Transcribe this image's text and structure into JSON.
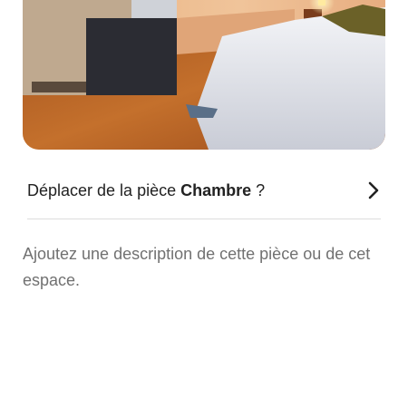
{
  "photo": {
    "icon": "bedroom-photo"
  },
  "room_link": {
    "prefix": "Déplacer de la pièce ",
    "room_name": "Chambre",
    "suffix": " ?",
    "icon": "chevron-right-icon"
  },
  "description": {
    "placeholder": "Ajoutez une description de cette pièce ou de cet espace."
  }
}
